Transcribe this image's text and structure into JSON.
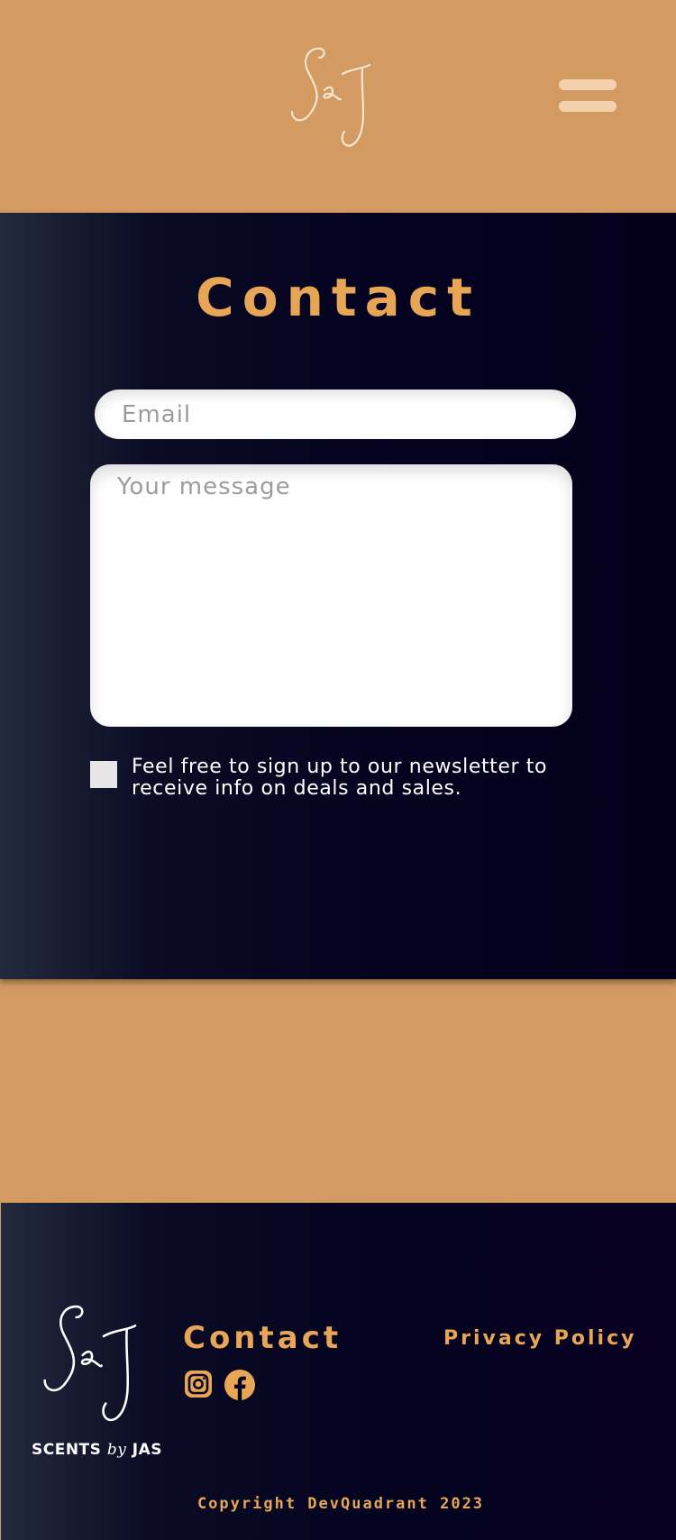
{
  "header": {
    "logo_icon": "sj-monogram-logo",
    "menu_icon": "hamburger-menu-icon"
  },
  "contact": {
    "title": "Contact",
    "email_placeholder": "Email",
    "message_placeholder": "Your message",
    "newsletter_label": "Feel free to sign up to our newsletter to receive info on deals and sales.",
    "newsletter_checked": false
  },
  "footer": {
    "brand_left": "SCENTS ",
    "brand_by": "by",
    "brand_right": " JAS",
    "contact_link": "Contact",
    "social_icons": [
      "instagram-icon",
      "facebook-icon"
    ],
    "privacy_link": "Privacy Policy",
    "copyright": "Copyright DevQuadrant 2023"
  },
  "colors": {
    "brand_tan": "#d39a62",
    "accent_gold": "#e6a656",
    "navy_dark": "#04021f",
    "navy_light": "#232a3d",
    "logo_cream": "#f6e5d0"
  }
}
